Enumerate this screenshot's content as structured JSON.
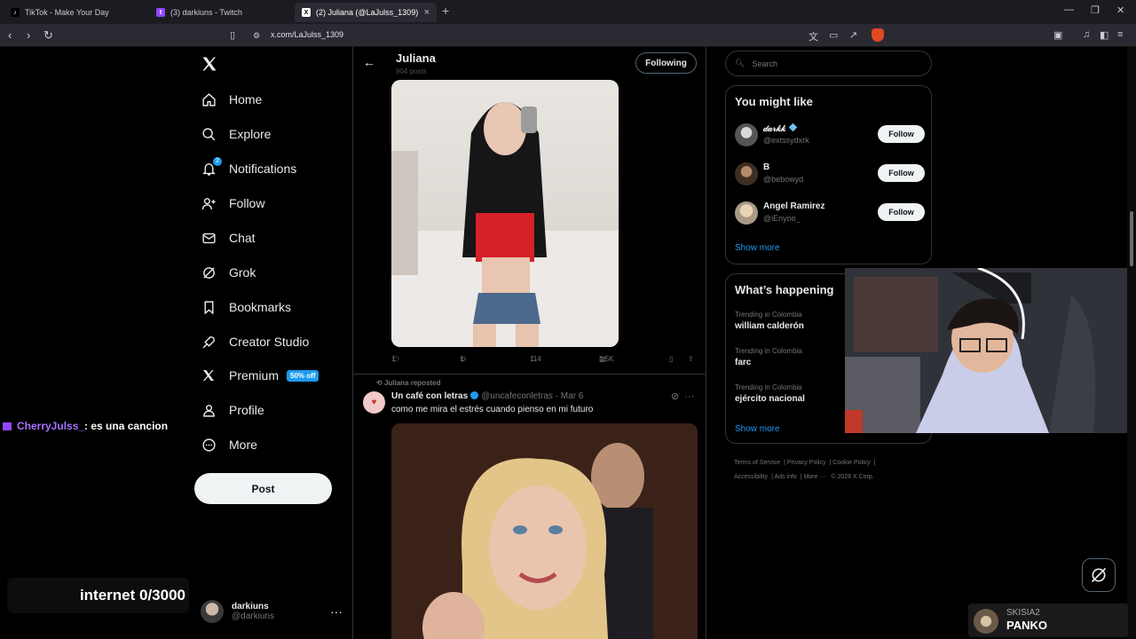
{
  "browser": {
    "tabs": [
      {
        "title": "TikTok - Make Your Day",
        "favicon": "tiktok-icon"
      },
      {
        "title": "(3) darkiuns - Twitch",
        "favicon": "twitch-icon"
      },
      {
        "title": "(2) Juliana (@LaJulss_1309) / X",
        "favicon": "x-icon",
        "active": true
      }
    ],
    "url": "x.com/LaJulss_1309"
  },
  "nav": {
    "items": [
      {
        "label": "Home",
        "icon": "home-icon"
      },
      {
        "label": "Explore",
        "icon": "search-icon"
      },
      {
        "label": "Notifications",
        "icon": "bell-icon",
        "badge": "2"
      },
      {
        "label": "Follow",
        "icon": "add-user-icon"
      },
      {
        "label": "Chat",
        "icon": "mail-icon"
      },
      {
        "label": "Grok",
        "icon": "grok-icon"
      },
      {
        "label": "Bookmarks",
        "icon": "bookmark-icon"
      },
      {
        "label": "Creator Studio",
        "icon": "rocket-icon"
      },
      {
        "label": "Premium",
        "icon": "x-icon",
        "promo": "50% off"
      },
      {
        "label": "Profile",
        "icon": "person-icon"
      },
      {
        "label": "More",
        "icon": "more-circle-icon"
      }
    ],
    "post_label": "Post"
  },
  "account": {
    "name": "darkiuns",
    "handle": "@darkiuns"
  },
  "stream": {
    "chat_user": "CherryJulss_",
    "chat_msg": ": es una cancion",
    "goal_text": "internet  0/3000",
    "sub_alert_line1": "SKISIA2",
    "sub_alert_line2": "PANKO"
  },
  "profile": {
    "name": "Juliana",
    "post_count": "904 posts",
    "following_label": "Following"
  },
  "tweet1": {
    "replies": "1",
    "reposts": "1",
    "likes": "114",
    "views": "1.5K"
  },
  "tweet2": {
    "repost_label": "Juliana reposted",
    "author": "Un café con letras",
    "handle": "@uncafeconletras",
    "date": "· Mar 6",
    "text": "como me mira el estrés cuando pienso en mi futuro"
  },
  "sidebar": {
    "search_placeholder": "Search",
    "might_like_title": "You might like",
    "suggestions": [
      {
        "name": "𝒹𝒶𝓇𝓀𝓀",
        "handle": "@extssydxrk",
        "button": "Follow"
      },
      {
        "name": "B",
        "handle": "@bebowyd",
        "button": "Follow"
      },
      {
        "name": "Angel Ramirez",
        "handle": "@iEnyoo_",
        "button": "Follow"
      }
    ],
    "show_more": "Show more",
    "happening_title": "What’s happening",
    "trends": [
      {
        "context": "Trending in Colombia",
        "title": "william calderón"
      },
      {
        "context": "Trending in Colombia",
        "title": "farc"
      },
      {
        "context": "Trending in Colombia",
        "title": "ejército nacional"
      }
    ],
    "footer": [
      "Terms of Service",
      "Privacy Policy",
      "Cookie Policy",
      "Accessibility",
      "Ads info",
      "More ···",
      "© 2026 X Corp."
    ]
  }
}
